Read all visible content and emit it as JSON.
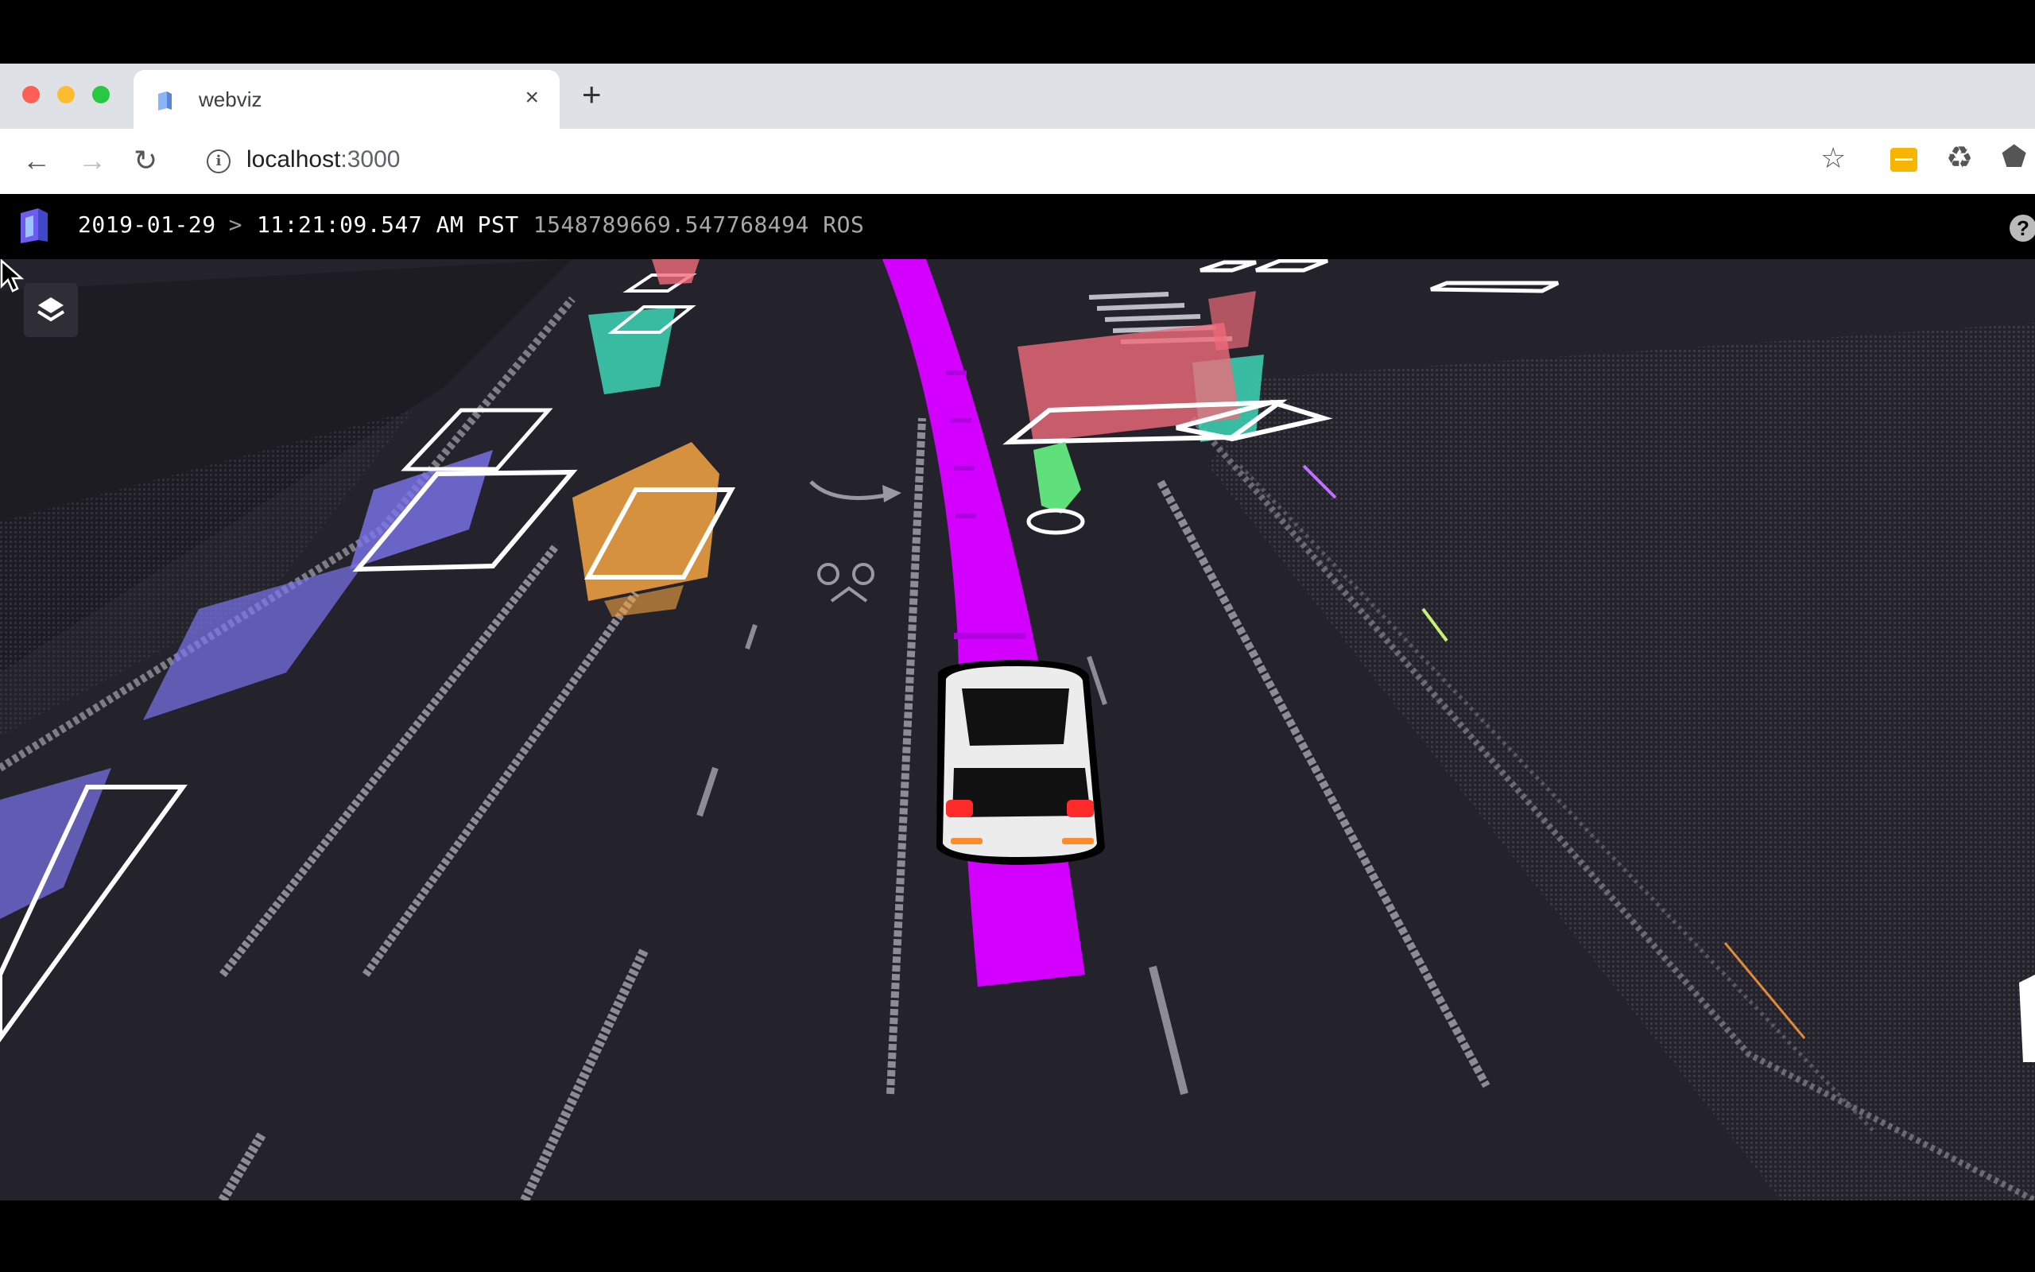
{
  "browser": {
    "tab": {
      "title": "webviz",
      "close_glyph": "×"
    },
    "new_tab_glyph": "+",
    "nav": {
      "back_glyph": "←",
      "forward_glyph": "→",
      "reload_glyph": "↻"
    },
    "url": {
      "host": "localhost",
      "port": ":3000"
    },
    "icons": [
      "star-icon",
      "extension-yellow-icon",
      "recycle-icon",
      "puzzle-icon"
    ]
  },
  "webviz": {
    "date": "2019-01-29",
    "separator": ">",
    "time": "11:21:09.547 AM PST",
    "ros_time": "1548789669.547768494 ROS",
    "help_glyph": "?",
    "brand_color": "#6e5bf0"
  },
  "scene": {
    "planned_path_color": "#d400ff",
    "ground_color": "#24232b",
    "cluster_colors": [
      "#f5a441",
      "#7b74ee",
      "#3dd6b6",
      "#f06b7a",
      "#5fe07a"
    ]
  }
}
